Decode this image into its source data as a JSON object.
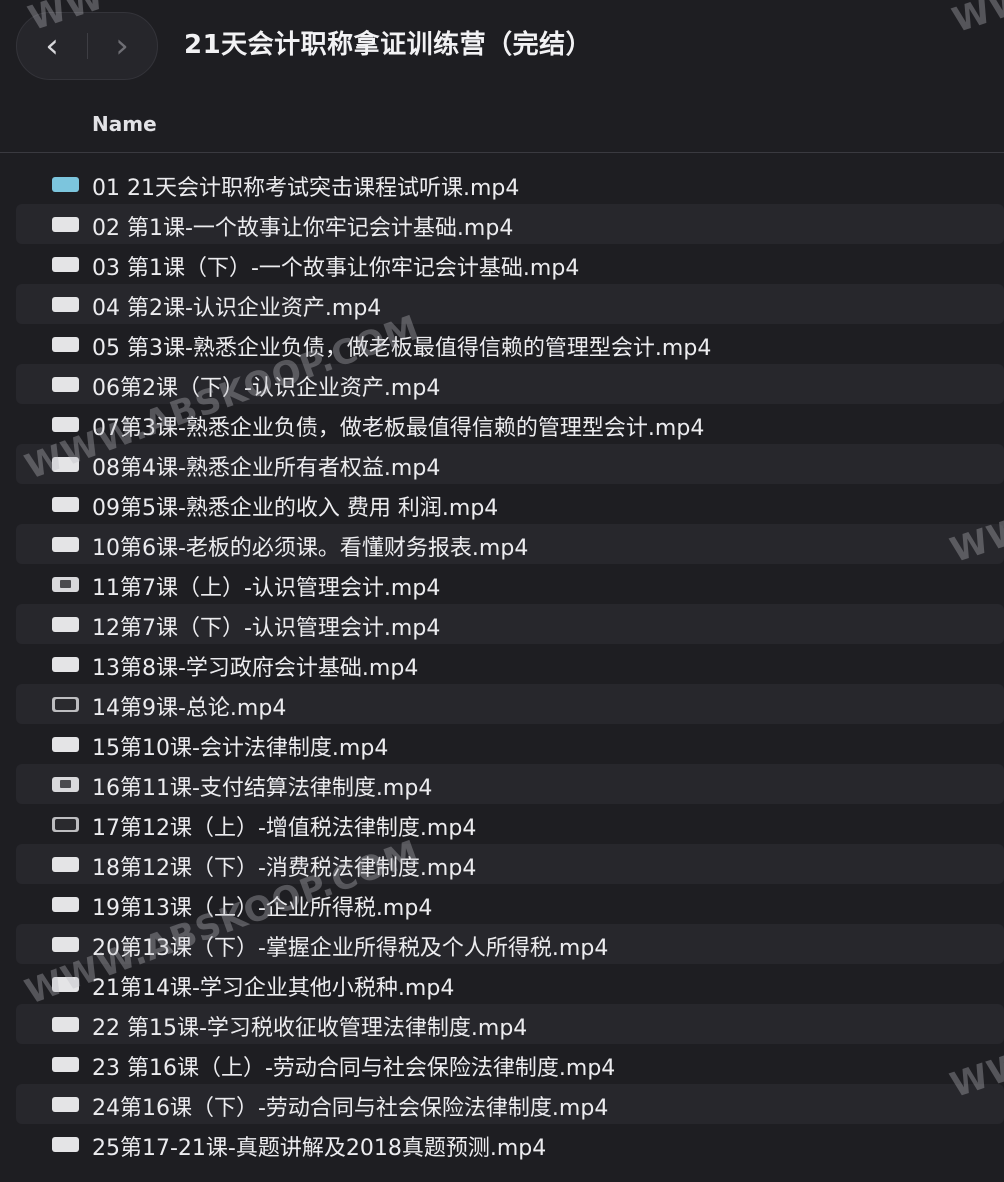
{
  "window": {
    "title": "21天会计职称拿证训练营（完结）",
    "back_icon": "‹",
    "forward_icon": "›"
  },
  "columns": {
    "name": "Name"
  },
  "files": [
    {
      "name": "01 21天会计职称考试突击课程试听课.mp4",
      "icon": "blue"
    },
    {
      "name": "02 第1课-一个故事让你牢记会计基础.mp4",
      "icon": "thumb"
    },
    {
      "name": "03 第1课（下）-一个故事让你牢记会计基础.mp4",
      "icon": "thumb"
    },
    {
      "name": "04 第2课-认识企业资产.mp4",
      "icon": "thumb"
    },
    {
      "name": "05 第3课-熟悉企业负债，做老板最值得信赖的管理型会计.mp4",
      "icon": "thumb"
    },
    {
      "name": "06第2课（下）-认识企业资产.mp4",
      "icon": "thumb"
    },
    {
      "name": "07第3课-熟悉企业负债，做老板最值得信赖的管理型会计.mp4",
      "icon": "thumb"
    },
    {
      "name": "08第4课-熟悉企业所有者权益.mp4",
      "icon": "thumb"
    },
    {
      "name": "09第5课-熟悉企业的收入 费用 利润.mp4",
      "icon": "thumb"
    },
    {
      "name": "10第6课-老板的必须课。看懂财务报表.mp4",
      "icon": "thumb"
    },
    {
      "name": "11第7课（上）-认识管理会计.mp4",
      "icon": "play"
    },
    {
      "name": "12第7课（下）-认识管理会计.mp4",
      "icon": "thumb"
    },
    {
      "name": "13第8课-学习政府会计基础.mp4",
      "icon": "thumb"
    },
    {
      "name": "14第9课-总论.mp4",
      "icon": "dark"
    },
    {
      "name": "15第10课-会计法律制度.mp4",
      "icon": "thumb"
    },
    {
      "name": "16第11课-支付结算法律制度.mp4",
      "icon": "play"
    },
    {
      "name": "17第12课（上）-增值税法律制度.mp4",
      "icon": "dark"
    },
    {
      "name": "18第12课（下）-消费税法律制度.mp4",
      "icon": "thumb"
    },
    {
      "name": "19第13课（上）-企业所得税.mp4",
      "icon": "thumb"
    },
    {
      "name": "20第13课（下）-掌握企业所得税及个人所得税.mp4",
      "icon": "thumb"
    },
    {
      "name": "21第14课-学习企业其他小税种.mp4",
      "icon": "thumb"
    },
    {
      "name": "22 第15课-学习税收征收管理法律制度.mp4",
      "icon": "thumb"
    },
    {
      "name": "23 第16课（上）-劳动合同与社会保险法律制度.mp4",
      "icon": "thumb"
    },
    {
      "name": "24第16课（下）-劳动合同与社会保险法律制度.mp4",
      "icon": "thumb"
    },
    {
      "name": "25第17-21课-真题讲解及2018真题预测.mp4",
      "icon": "thumb"
    }
  ],
  "watermark": {
    "text": "WWW.ABSKOOP.COM",
    "edge_text": "WW"
  }
}
